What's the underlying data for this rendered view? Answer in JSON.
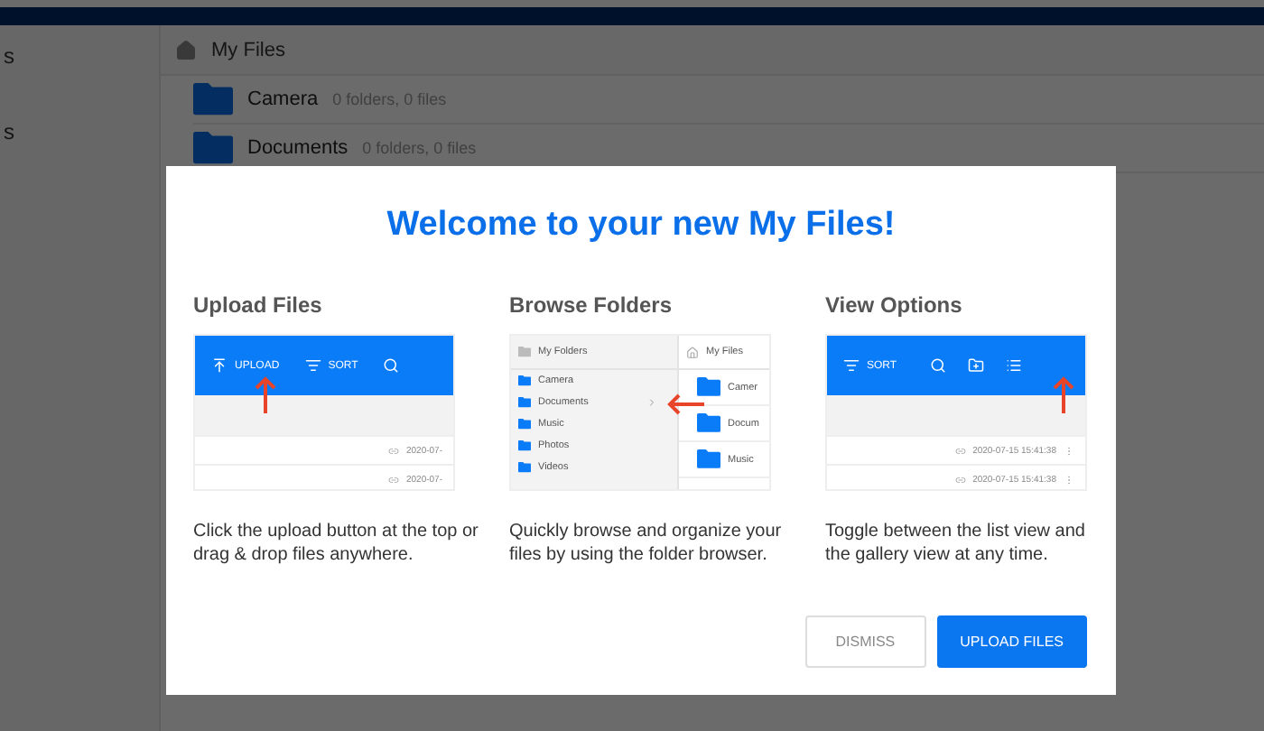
{
  "sidebar": {
    "items": [
      "s",
      "s"
    ]
  },
  "breadcrumb": {
    "label": "My Files"
  },
  "folders": [
    {
      "name": "Camera",
      "info": "0 folders, 0 files"
    },
    {
      "name": "Documents",
      "info": "0 folders, 0 files"
    }
  ],
  "dialog": {
    "title": "Welcome to your new My Files!",
    "sections": [
      {
        "kind": "upload",
        "heading": "Upload Files",
        "toolbar": [
          "UPLOAD",
          "SORT"
        ],
        "rows": [
          "2020-07-",
          "2020-07-"
        ],
        "description": "Click the upload button at the top or drag & drop files anywhere."
      },
      {
        "kind": "browse",
        "heading": "Browse Folders",
        "tree_title": "My Folders",
        "tree": [
          "Camera",
          "Documents",
          "Music",
          "Photos",
          "Videos"
        ],
        "pane_title": "My Files",
        "pane": [
          "Camer",
          "Docum",
          "Music"
        ],
        "description": "Quickly browse and organize your files by using the folder browser."
      },
      {
        "kind": "view",
        "heading": "View Options",
        "toolbar": [
          "SORT"
        ],
        "rows": [
          "2020-07-15 15:41:38",
          "2020-07-15 15:41:38"
        ],
        "description": "Toggle between the list view and the gallery view at any time."
      }
    ],
    "buttons": [
      {
        "label": "DISMISS",
        "kind": "secondary"
      },
      {
        "label": "UPLOAD FILES",
        "kind": "primary"
      }
    ]
  }
}
